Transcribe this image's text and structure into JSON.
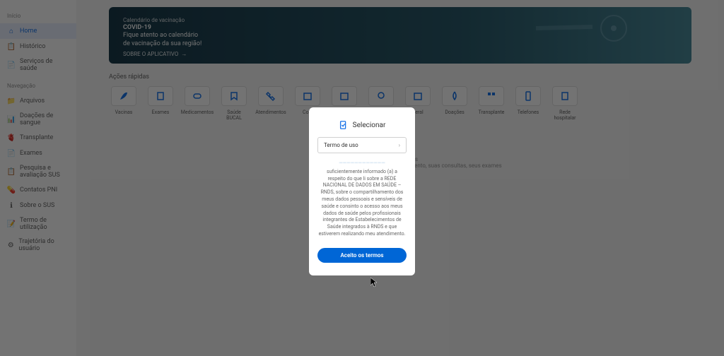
{
  "sidebar": {
    "section1": "Início",
    "items1": [
      {
        "icon": "⌂",
        "label": "Home",
        "active": true
      },
      {
        "icon": "📋",
        "label": "Histórico"
      },
      {
        "icon": "📄",
        "label": "Serviços de saúde"
      }
    ],
    "section2": "Navegação",
    "items2": [
      {
        "icon": "📁",
        "label": "Arquivos"
      },
      {
        "icon": "📊",
        "label": "Doações de sangue"
      },
      {
        "icon": "🫀",
        "label": "Transplante"
      },
      {
        "icon": "📄",
        "label": "Exames"
      },
      {
        "icon": "📋",
        "label": "Pesquisa e avaliação SUS"
      },
      {
        "icon": "💊",
        "label": "Contatos PNI"
      },
      {
        "icon": "ℹ",
        "label": "Sobre o SUS"
      },
      {
        "icon": "📝",
        "label": "Termo de utilização"
      },
      {
        "icon": "⚙",
        "label": "Trajetória do usuário"
      }
    ]
  },
  "banner": {
    "sub": "Calendário de vacinação",
    "title": "COVID-19",
    "text1": "Fique atento ao calendário",
    "text2": "de vacinação da sua região!",
    "link": "SOBRE O APLICATIVO"
  },
  "sectionTitle": "Ações rápidas",
  "actions": [
    {
      "label": "Vacinas"
    },
    {
      "label": "Exames"
    },
    {
      "label": "Medicamentos"
    },
    {
      "label": "Saúde BUCAL"
    },
    {
      "label": "Atendimentos"
    },
    {
      "label": "Cole"
    },
    {
      "label": ""
    },
    {
      "label": ""
    },
    {
      "label": "geral"
    },
    {
      "label": "Doações"
    },
    {
      "label": "Transplante"
    },
    {
      "label": "Telefones"
    },
    {
      "label": "Rede hospitalar"
    }
  ],
  "contentHints": {
    "line1": "ouvidorias",
    "line2": "teleatendimento, suas consultas, seus exames"
  },
  "modal": {
    "title": "Selecionar",
    "selectLabel": "Termo de uso",
    "bodyBlur": "————————————",
    "body": "suficientemente informado (a) a respeito do que li sobre a REDE NACIONAL DE DADOS EM SAÚDE – RNDS, sobre o compartilhamento dos meus dados pessoais e sensíveis de saúde e consinto o acesso aos meus dados de saúde pelos profissionais integrantes de Estabelecimentos de Saúde integrados à RNDS e que estiverem realizando meu atendimento.",
    "button": "Aceito os termos"
  }
}
